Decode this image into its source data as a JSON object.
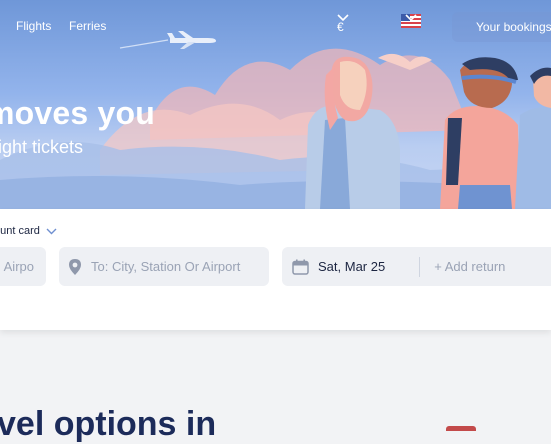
{
  "nav": {
    "links": [
      "Flights",
      "Ferries"
    ],
    "currency": "€",
    "bookings": "Your bookings"
  },
  "hero": {
    "headline": "moves you",
    "subline": "ight tickets"
  },
  "search": {
    "discount_label": "ount card",
    "from_placeholder": "Airpo",
    "to_placeholder": "To: City, Station Or Airport",
    "date_value": "Sat, Mar 25",
    "return_label": "+ Add return"
  },
  "section": {
    "heading": "vel options in"
  },
  "colors": {
    "hero_top": "#6f97d8",
    "accent_text": "#1c2b5a"
  },
  "icons": [
    "airplane-icon",
    "chevron-down-icon",
    "us-flag-icon",
    "location-pin-icon",
    "calendar-icon"
  ]
}
